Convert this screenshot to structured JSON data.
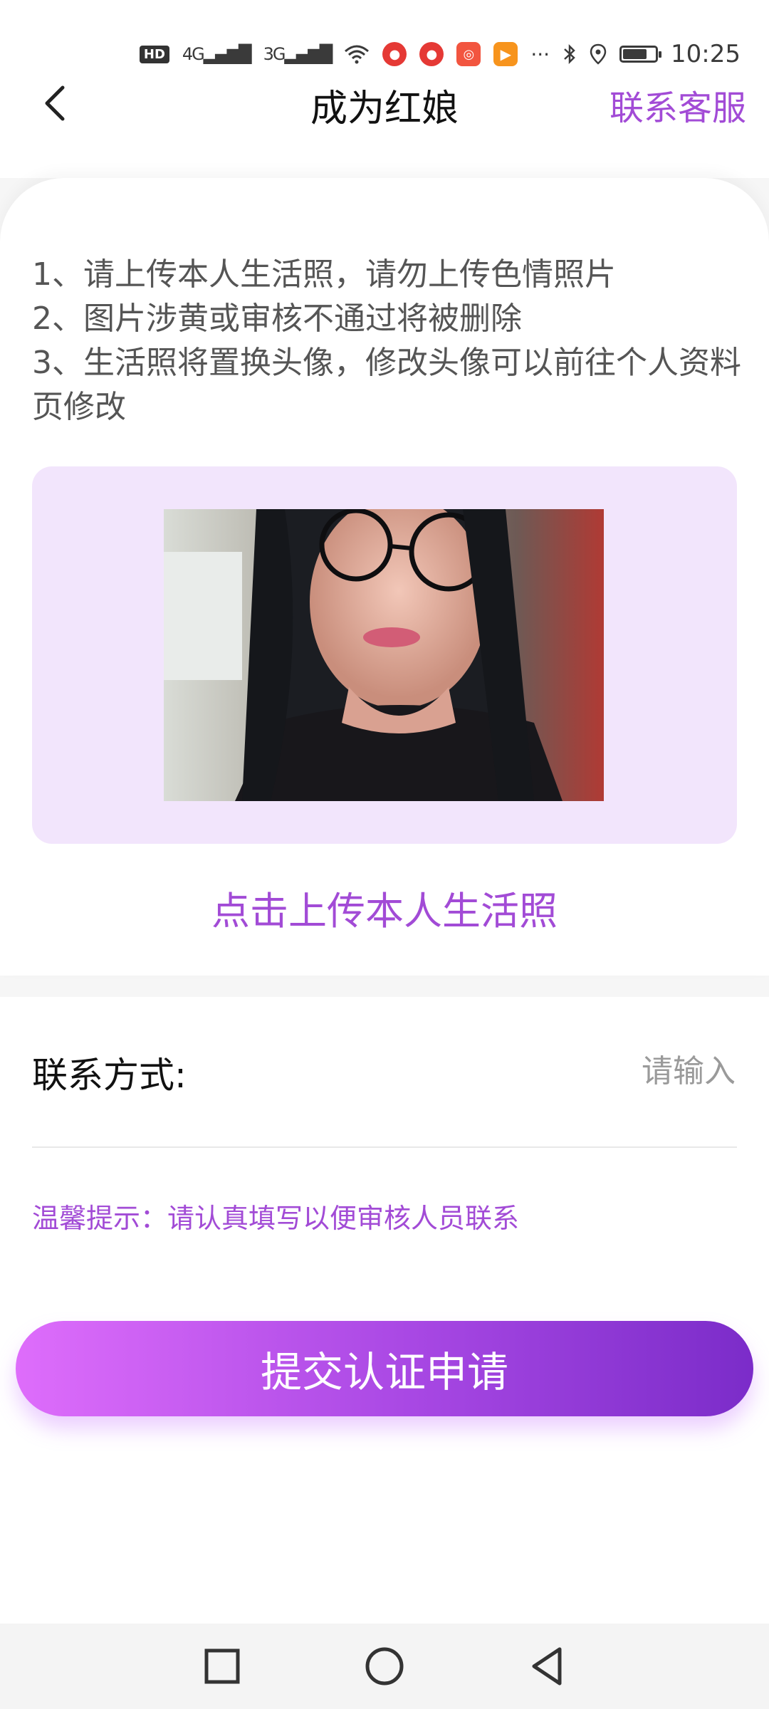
{
  "status_bar": {
    "time": "10:25",
    "hd_label": "HD",
    "signal_1": "4G",
    "signal_2": "3G",
    "dots": "···",
    "battery_level": 0.75
  },
  "header": {
    "title": "成为红娘",
    "support_link": "联系客服"
  },
  "rules": [
    "1、请上传本人生活照，请勿上传色情照片",
    "2、图片涉黄或审核不通过将被删除",
    "3、生活照将置换头像，修改头像可以前往个人资料页修改"
  ],
  "upload": {
    "label": "点击上传本人生活照"
  },
  "form": {
    "contact_label": "联系方式:",
    "contact_placeholder": "请输入",
    "contact_value": "",
    "tip": "温馨提示：请认真填写以便审核人员联系",
    "submit_label": "提交认证申请"
  },
  "colors": {
    "accent": "#a24bd6",
    "upload_bg": "#f2e5fc",
    "button_gradient_start": "#de6dfb",
    "button_gradient_end": "#7b2cc9"
  },
  "icons": {
    "back": "chevron-left-icon",
    "nav_recent": "square-icon",
    "nav_home": "circle-icon",
    "nav_back": "triangle-back-icon"
  }
}
